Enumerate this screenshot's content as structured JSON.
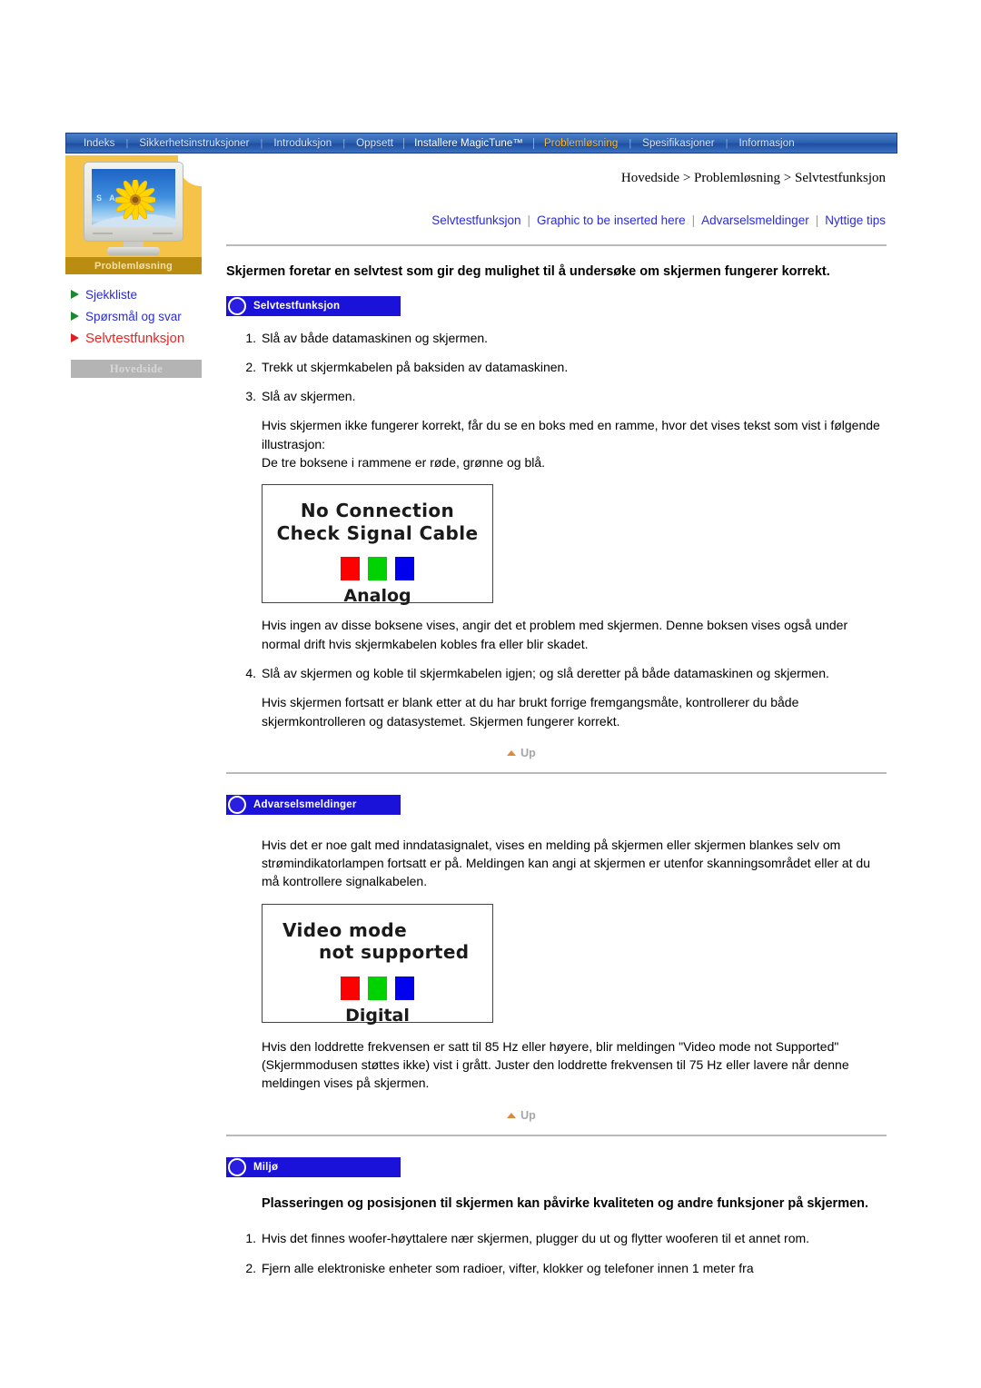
{
  "topnav": {
    "items": [
      {
        "label": "Indeks",
        "state": "normal"
      },
      {
        "label": "Sikkerhetsinstruksjoner",
        "state": "normal"
      },
      {
        "label": "Introduksjon",
        "state": "normal"
      },
      {
        "label": "Oppsett",
        "state": "normal"
      },
      {
        "label": "Installere MagicTune™",
        "state": "boxed"
      },
      {
        "label": "Problemløsning",
        "state": "active"
      },
      {
        "label": "Spesifikasjoner",
        "state": "normal"
      },
      {
        "label": "Informasjon",
        "state": "normal"
      }
    ],
    "separator": "|",
    "active_color": "#f5b83a",
    "bar_color": "#2e63b4"
  },
  "sidebar": {
    "section_label": "Problemløsning",
    "monitor_screen_text": "S A",
    "items": [
      {
        "label": "Sjekkliste",
        "current": false
      },
      {
        "label": "Spørsmål og svar",
        "current": false
      },
      {
        "label": "Selvtestfunksjon",
        "current": true
      }
    ],
    "home_button": "Hovedside"
  },
  "breadcrumb": {
    "text": "Hovedside > Problemløsning > Selvtestfunksjon"
  },
  "subnav": {
    "items": [
      "Selvtestfunksjon",
      "Graphic to be inserted here",
      "Advarselsmeldinger",
      "Nyttige tips"
    ],
    "separator": "|"
  },
  "main": {
    "lead": "Skjermen foretar en selvtest som gir deg mulighet til å undersøke om skjermen fungerer korrekt.",
    "section1": {
      "banner": "Selvtestfunksjon",
      "step1": "Slå av både datamaskinen og skjermen.",
      "step2": "Trekk ut skjermkabelen på baksiden av datamaskinen.",
      "step3": "Slå av skjermen.",
      "after3_line1": "Hvis skjermen ikke fungerer korrekt, får du se en boks med en ramme, hvor det vises tekst som vist i følgende illustrasjon:",
      "after3_line2": "De tre boksene i rammene er røde, grønne og blå.",
      "image_analog": {
        "line1": "No Connection",
        "line2": "Check Signal Cable",
        "footer": "Analog",
        "swatches": [
          "#ff0000",
          "#00d200",
          "#0000ee"
        ]
      },
      "after_image": "Hvis ingen av disse boksene vises, angir det et problem med skjermen. Denne boksen vises også under normal drift hvis skjermkabelen kobles fra eller blir skadet.",
      "step4": "Slå av skjermen og koble til skjermkabelen igjen; og slå deretter på både datamaskinen og skjermen.",
      "after4": "Hvis skjermen fortsatt er blank etter at du har brukt forrige fremgangsmåte, kontrollerer du både skjermkontrolleren og datasystemet. Skjermen fungerer korrekt.",
      "up_label": "Up"
    },
    "section2": {
      "banner": "Advarselsmeldinger",
      "intro": "Hvis det er noe galt med inndatasignalet, vises en melding på skjermen eller skjermen blankes selv om strømindikatorlampen fortsatt er på. Meldingen kan angi at skjermen er utenfor skanningsområdet eller at du må kontrollere signalkabelen.",
      "image_digital": {
        "line1": "Video mode",
        "line2": "not supported",
        "footer": "Digital",
        "swatches": [
          "#ff0000",
          "#00d200",
          "#0000ee"
        ]
      },
      "after_image": "Hvis den loddrette frekvensen er satt til 85 Hz eller høyere, blir meldingen \"Video mode not Supported\" (Skjermmodusen støttes ikke) vist i grått. Juster den loddrette frekvensen til 75 Hz eller lavere når denne meldingen vises på skjermen.",
      "up_label": "Up"
    },
    "section3": {
      "banner": "Miljø",
      "lead": "Plasseringen og posisjonen til skjermen kan påvirke kvaliteten og andre funksjoner på skjermen.",
      "step1": "Hvis det finnes woofer-høyttalere nær skjermen, plugger du ut og flytter wooferen til et annet rom.",
      "step2": "Fjern alle elektroniske enheter som radioer, vifter, klokker og telefoner innen 1 meter fra"
    }
  }
}
